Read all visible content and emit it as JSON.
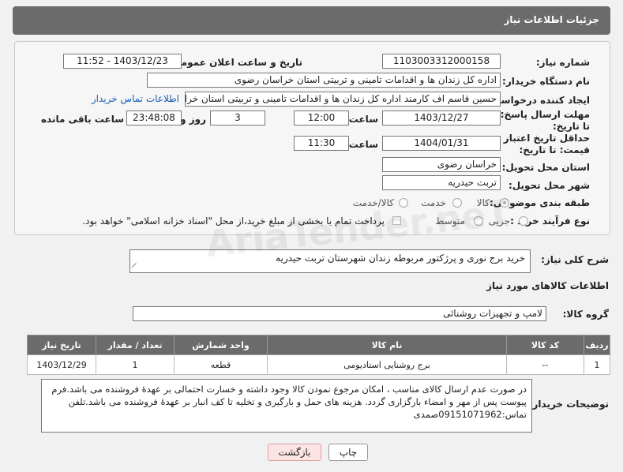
{
  "header": {
    "title": "جزئیات اطلاعات نیاز"
  },
  "form": {
    "need_number": {
      "label": "شماره نیاز:",
      "value": "1103003312000158"
    },
    "announce": {
      "label": "تاریخ و ساعت اعلان عمومی:",
      "value": "1403/12/23 - 11:52"
    },
    "buyer_org": {
      "label": "نام دستگاه خریدار:",
      "value": "اداره کل زندان ها و اقدامات تامینی و تربیتی استان خراسان رضوی"
    },
    "creator": {
      "label": "ایجاد کننده درخواست:",
      "value": "حسین قاسم اف کارمند اداره کل زندان ها و اقدامات تامینی و تربیتی استان خراسان",
      "contact_link": "اطلاعات تماس خریدار"
    },
    "reply_deadline": {
      "label": "مهلت ارسال پاسخ: تا تاریخ:",
      "date": "1403/12/27",
      "time_label": "ساعت",
      "time": "12:00",
      "days": "3",
      "days_label": "روز و",
      "remaining": "23:48:08",
      "remaining_label": "ساعت باقی مانده"
    },
    "price_validity": {
      "label": "حداقل تاریخ اعتبار قیمت: تا تاریخ:",
      "date": "1404/01/31",
      "time_label": "ساعت",
      "time": "11:30"
    },
    "province": {
      "label": "استان محل تحویل:",
      "value": "خراسان رضوی"
    },
    "city": {
      "label": "شهر محل تحویل:",
      "value": "تربت حیدریه"
    },
    "category": {
      "label": "طبقه بندی موضوعی:",
      "options": [
        "کالا",
        "خدمت",
        "کالا/خدمت"
      ]
    },
    "purchase_type": {
      "label": "نوع فرآیند خرید :",
      "options": [
        "جزیی",
        "متوسط"
      ],
      "payment_note": "پرداخت تمام یا بخشی از مبلغ خرید،از محل \"اسناد خزانه اسلامی\" خواهد بود."
    }
  },
  "description": {
    "label": "شرح کلی نیاز:",
    "value": "خرید برج نوری و پرژکتور مربوطه زندان شهرستان تربت حیدریه"
  },
  "goods": {
    "section_title": "اطلاعات کالاهای مورد نیاز",
    "group_label": "گروه کالا:",
    "group_value": "لامپ و تجهیزات روشنائی",
    "columns": [
      "ردیف",
      "کد کالا",
      "نام کالا",
      "واحد شمارش",
      "تعداد / مقدار",
      "تاریخ نیاز"
    ],
    "rows": [
      [
        "1",
        "--",
        "برج روشنایی استادیومی",
        "قطعه",
        "1",
        "1403/12/29"
      ]
    ]
  },
  "buyer_notes": {
    "label": "توضیحات خریدار:",
    "value": "در صورت عدم  ارسال کالای مناسب  ،  امکان مرجوع نمودن کالا  وجود داشته و خسارت احتمالی بر عهدۀ فروشنده می باشد.فرم پیوست پس از مهر و امضاء بارگزاری گردد. هزینه های حمل و بارگیری و تخلیه تا کف انبار بر عهدۀ فروشنده می باشد.تلفن تماس:09151071962صمدی"
  },
  "buttons": {
    "print": "چاپ",
    "back": "بازگشت"
  },
  "watermark": "AriaTender.neT"
}
